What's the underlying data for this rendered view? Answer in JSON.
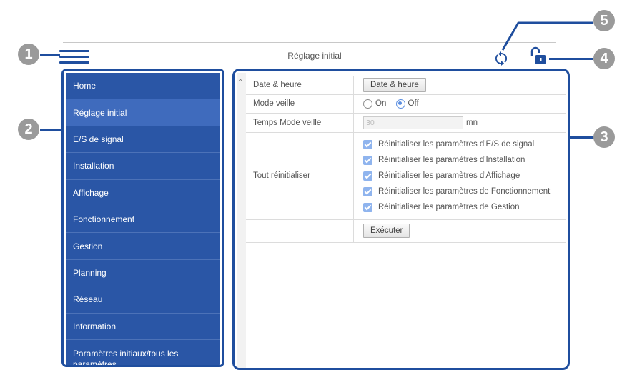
{
  "header": {
    "title": "Réglage initial"
  },
  "icons": {
    "menu": "hamburger-menu-icon",
    "refresh": "refresh-icon",
    "lock": "unlocked-lock-icon"
  },
  "colors": {
    "accent": "#1f4e9e",
    "sidebar_bg": "#2a56a6",
    "sidebar_active": "#3f6bbd",
    "checkbox": "#8fb4ee",
    "callout": "#9a9a9a"
  },
  "sidebar": {
    "items": [
      {
        "label": "Home",
        "active": false
      },
      {
        "label": "Réglage initial",
        "active": true
      },
      {
        "label": "E/S de signal",
        "active": false
      },
      {
        "label": "Installation",
        "active": false
      },
      {
        "label": "Affichage",
        "active": false
      },
      {
        "label": "Fonctionnement",
        "active": false
      },
      {
        "label": "Gestion",
        "active": false
      },
      {
        "label": "Planning",
        "active": false
      },
      {
        "label": "Réseau",
        "active": false
      },
      {
        "label": "Information",
        "active": false
      },
      {
        "label": "Paramètres initiaux/tous les paramètres",
        "active": false
      }
    ]
  },
  "settings": {
    "date_time": {
      "label": "Date & heure",
      "button": "Date & heure"
    },
    "sleep_mode": {
      "label": "Mode veille",
      "option_on": "On",
      "option_off": "Off",
      "selected": "Off"
    },
    "sleep_time": {
      "label": "Temps Mode veille",
      "value": "30",
      "unit": "mn"
    },
    "reset_all": {
      "label": "Tout réinitialiser",
      "options": [
        "Réinitialiser les paramètres d'E/S de signal",
        "Réinitialiser les paramètres d'Installation",
        "Réinitialiser les paramètres d'Affichage",
        "Réinitialiser les paramètres de Fonctionnement",
        "Réinitialiser les paramètres de Gestion"
      ],
      "execute_button": "Exécuter"
    }
  },
  "callouts": [
    "1",
    "2",
    "3",
    "4",
    "5"
  ]
}
